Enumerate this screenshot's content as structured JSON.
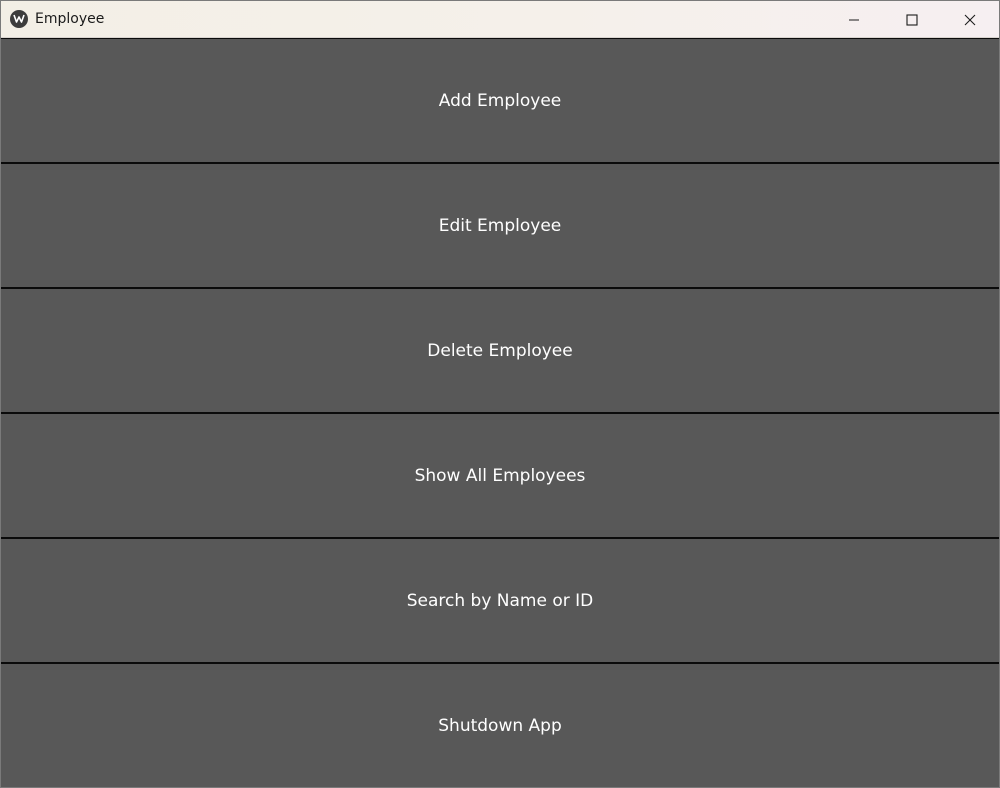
{
  "window": {
    "title": "Employee"
  },
  "menu": {
    "items": [
      {
        "label": "Add Employee"
      },
      {
        "label": "Edit Employee"
      },
      {
        "label": "Delete Employee"
      },
      {
        "label": "Show All Employees"
      },
      {
        "label": "Search by Name or ID"
      },
      {
        "label": "Shutdown App"
      }
    ]
  },
  "colors": {
    "button_bg": "#585858",
    "button_text": "#ffffff",
    "separator": "#0b0b0b"
  }
}
